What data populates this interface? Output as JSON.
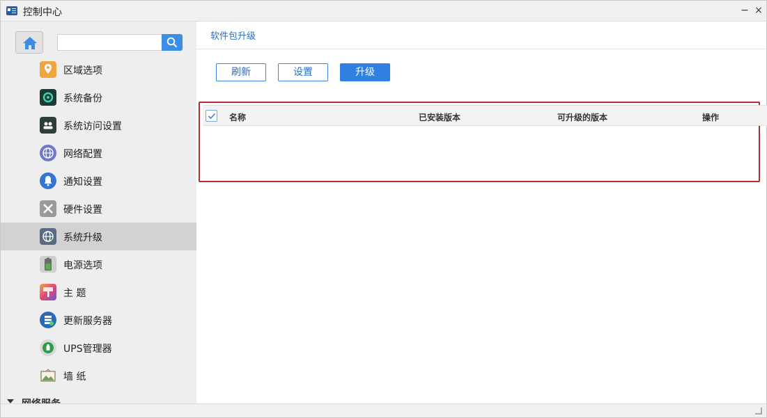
{
  "window": {
    "title": "控制中心",
    "minimize_label": "−",
    "close_label": "×"
  },
  "sidebar": {
    "search": {
      "value": "",
      "placeholder": ""
    },
    "items": [
      {
        "label": "区域选项",
        "icon": "region-pin-icon",
        "color": "#f0a640"
      },
      {
        "label": "系统备份",
        "icon": "backup-icon",
        "color": "#1d3b34"
      },
      {
        "label": "系统访问设置",
        "icon": "access-users-icon",
        "color": "#2d3f38"
      },
      {
        "label": "网络配置",
        "icon": "network-globe-icon",
        "color": "#6d78c8"
      },
      {
        "label": "通知设置",
        "icon": "notification-bell-icon",
        "color": "#3574d0"
      },
      {
        "label": "硬件设置",
        "icon": "hardware-tools-icon",
        "color": "#9a9a9a"
      },
      {
        "label": "系统升级",
        "icon": "system-upgrade-globe-icon",
        "color": "#5a6a84",
        "active": true
      },
      {
        "label": "电源选项",
        "icon": "power-battery-icon",
        "color": "#5cae4c"
      },
      {
        "label": "主 题",
        "icon": "theme-brush-icon",
        "color": "#e0487c"
      },
      {
        "label": "更新服务器",
        "icon": "update-server-icon",
        "color": "#2a68b8"
      },
      {
        "label": "UPS管理器",
        "icon": "ups-icon",
        "color": "#2f9a48"
      },
      {
        "label": "墙 纸",
        "icon": "wallpaper-picture-icon",
        "color": "#7a9a64"
      }
    ],
    "section": {
      "label": "网络服务"
    }
  },
  "main": {
    "breadcrumb": "软件包升级",
    "buttons": {
      "refresh": "刷新",
      "settings": "设置",
      "upgrade": "升级"
    },
    "table": {
      "columns": [
        "名称",
        "已安装版本",
        "可升级的版本",
        "操作"
      ],
      "rows": []
    }
  },
  "colors": {
    "accent": "#2f80e0",
    "highlight_border": "#b03030",
    "sidebar_bg": "#eeeeee",
    "active_item_bg": "#d2d2d2"
  }
}
